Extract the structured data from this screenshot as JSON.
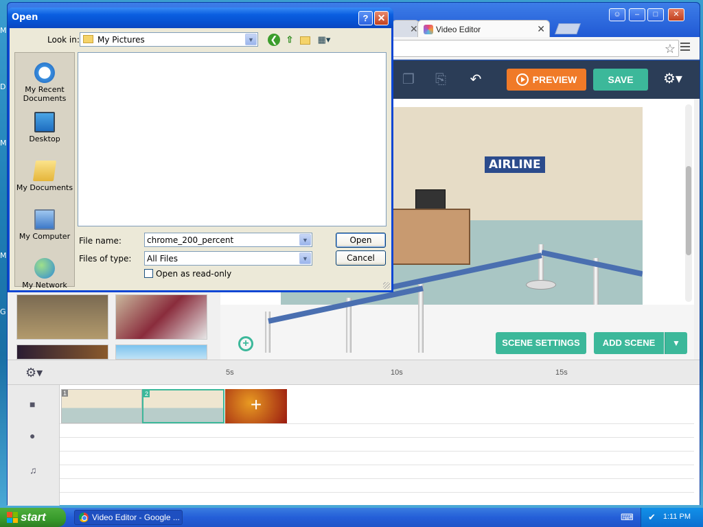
{
  "dialog": {
    "title": "Open",
    "look_in_label": "Look in:",
    "look_in_value": "My Pictures",
    "places": [
      "My Recent Documents",
      "Desktop",
      "My Documents",
      "My Computer",
      "My Network"
    ],
    "file_name_label": "File name:",
    "file_name_value": "chrome_200_percent",
    "file_type_label": "Files of type:",
    "file_type_value": "All Files",
    "open_label": "Open",
    "cancel_label": "Cancel",
    "readonly_label": "Open as read-only"
  },
  "browser": {
    "active_tab": "Video Editor"
  },
  "editor": {
    "preview_label": "PREVIEW",
    "save_label": "SAVE",
    "scene_settings_label": "SCENE SETTINGS",
    "add_scene_label": "ADD SCENE",
    "airline_sign": "AIRLINE",
    "colors": {
      "accent_orange": "#f07a28",
      "accent_green": "#3cb89a",
      "topbar": "#2b3d57"
    }
  },
  "timeline": {
    "ticks": [
      "5s",
      "10s",
      "15s"
    ],
    "clips": [
      "1",
      "2"
    ],
    "add_clip_symbol": "+"
  },
  "taskbar": {
    "start_label": "start",
    "task_label": "Video Editor - Google ...",
    "clock": "1:11 PM"
  },
  "desktop_letters": [
    "M",
    "D",
    "M",
    "M",
    "G"
  ]
}
